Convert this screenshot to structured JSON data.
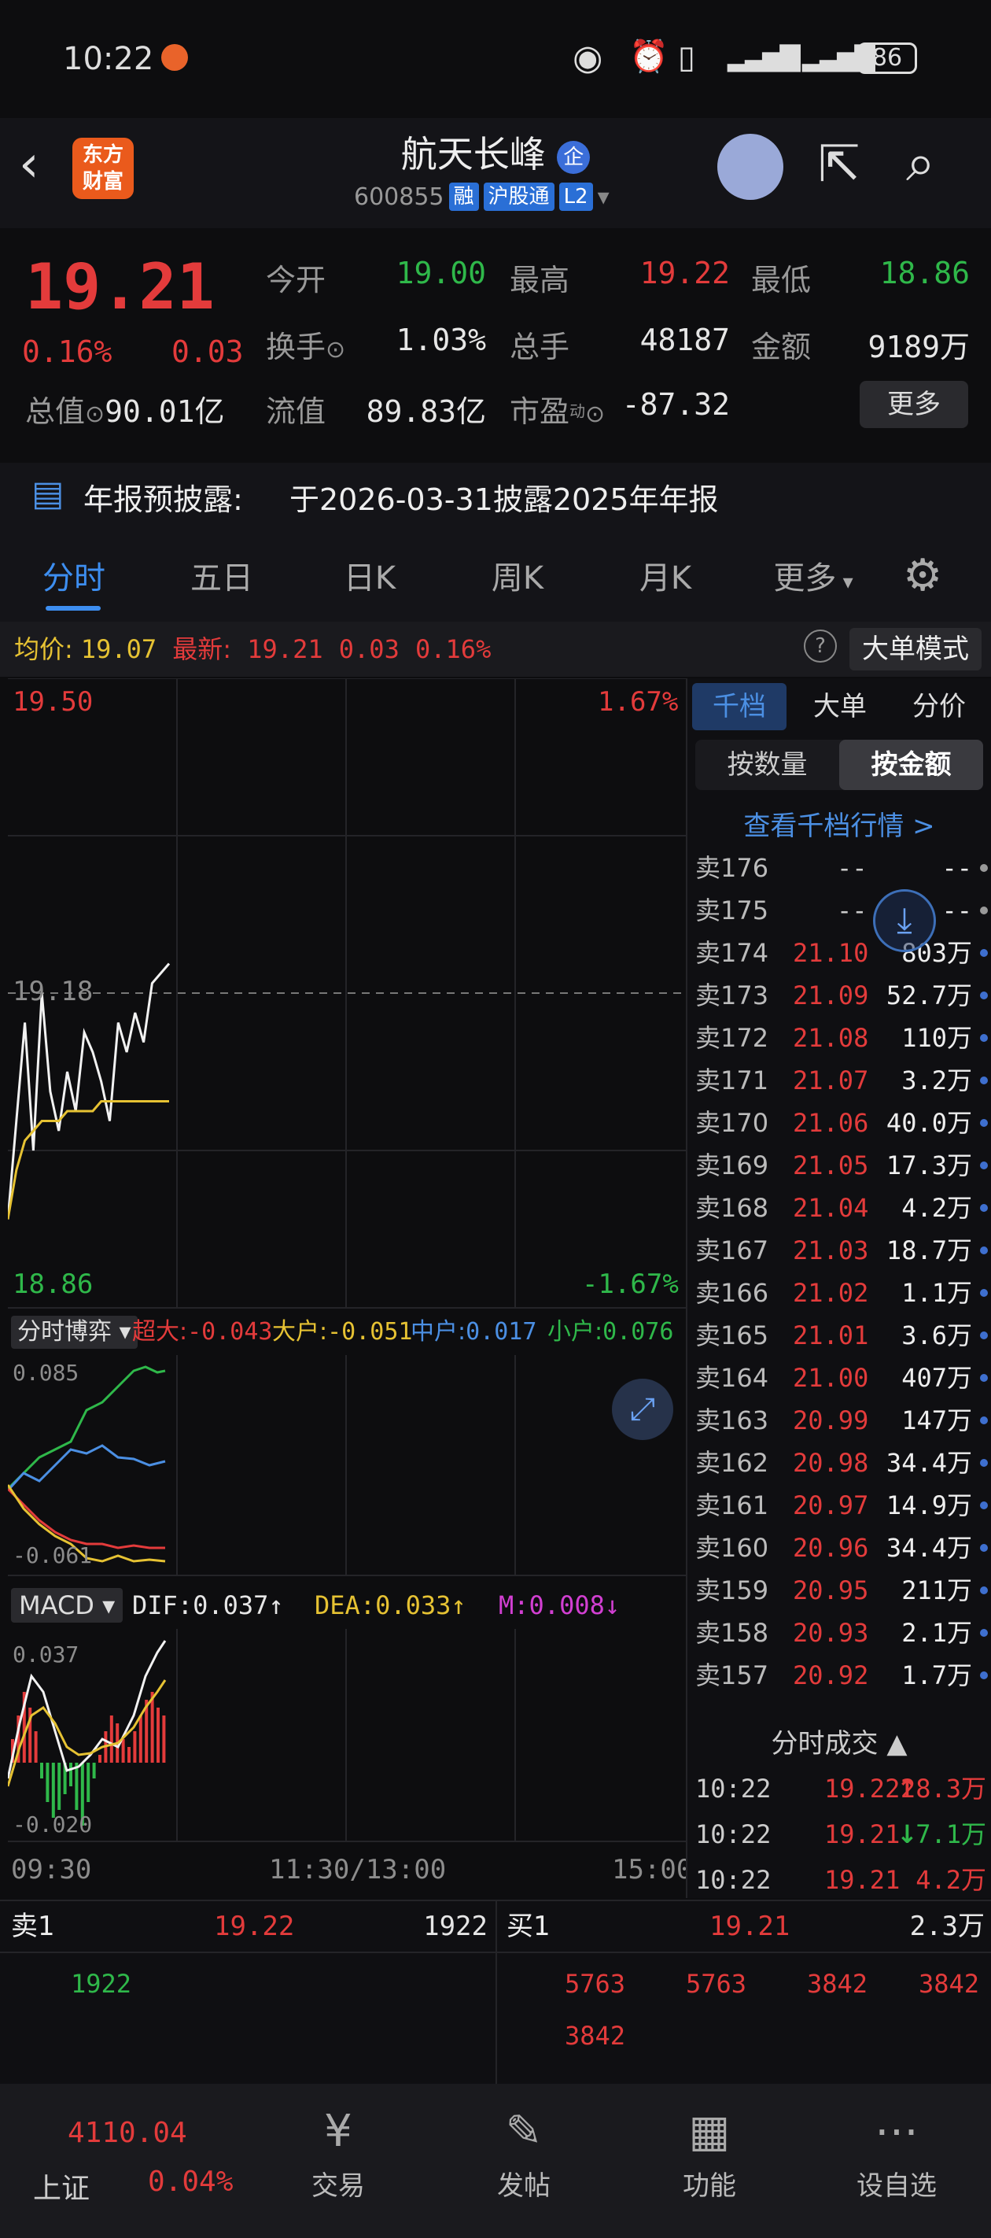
{
  "status": {
    "time": "10:22",
    "battery": "86"
  },
  "header": {
    "logo": [
      "东方",
      "财富"
    ],
    "title": "航天长峰",
    "badge": "企",
    "code": "600855",
    "tags": [
      "融",
      "沪股通",
      "L2"
    ]
  },
  "quote": {
    "price": "19.21",
    "change_pct": "0.16%",
    "change": "0.03",
    "fields": [
      {
        "label": "今开",
        "value": "19.00"
      },
      {
        "label": "最高",
        "value": "19.22"
      },
      {
        "label": "最低",
        "value": "18.86"
      },
      {
        "label": "换手",
        "value": "1.03%"
      },
      {
        "label": "总手",
        "value": "48187"
      },
      {
        "label": "金额",
        "value": "9189万"
      },
      {
        "label": "总值",
        "value": "90.01亿"
      },
      {
        "label": "流值",
        "value": "89.83亿"
      },
      {
        "label": "市盈",
        "value": "-87.32"
      }
    ],
    "pe_sup": "动",
    "more": "更多"
  },
  "notice": {
    "label": "年报预披露:",
    "text": "于2026-03-31披露2025年年报"
  },
  "tabs": [
    "分时",
    "五日",
    "日K",
    "周K",
    "月K",
    "更多"
  ],
  "infobar": {
    "avg_label": "均价:",
    "avg": "19.07",
    "new_label": "最新:",
    "new_price": "19.21",
    "new_chg": "0.03",
    "new_pct": "0.16%",
    "mode_btn": "大单模式"
  },
  "chart": {
    "price_top": "19.50",
    "pct_top": "1.67%",
    "price_bottom": "18.86",
    "pct_bottom": "-1.67%",
    "ref_line": "19.18",
    "time_start": "09:30",
    "time_mid": "11:30/13:00",
    "time_end": "15:00"
  },
  "chart_data": {
    "type": "line",
    "ylim": [
      18.86,
      19.5
    ],
    "series": [
      {
        "name": "",
        "values": [
          18.95,
          19.05,
          19.15,
          19.02,
          19.18,
          19.08,
          19.04,
          19.1,
          19.06,
          19.14,
          19.12,
          19.09,
          19.05,
          19.15,
          19.12,
          19.16,
          19.13,
          19.19,
          19.2,
          19.21
        ]
      },
      {
        "name": "均价",
        "values": [
          18.95,
          19.0,
          19.03,
          19.04,
          19.05,
          19.05,
          19.05,
          19.06,
          19.06,
          19.06,
          19.06,
          19.07,
          19.07,
          19.07,
          19.07,
          19.07,
          19.07,
          19.07,
          19.07,
          19.07
        ]
      }
    ]
  },
  "fund_flow": {
    "selector": "分时博弈",
    "items": [
      {
        "label": "超大:",
        "value": "-0.043"
      },
      {
        "label": "大户:",
        "value": "-0.051"
      },
      {
        "label": "中户:",
        "value": "0.017"
      },
      {
        "label": "小户:",
        "value": "0.076"
      }
    ],
    "ytop": "0.085",
    "ybottom": "-0.061"
  },
  "macd": {
    "selector": "MACD",
    "dif": "DIF:0.037",
    "dif_arrow": "↑",
    "dea": "DEA:0.033",
    "dea_arrow": "↑",
    "m": "M:0.008",
    "m_arrow": "↓",
    "ytop": "0.037",
    "ybottom": "-0.020"
  },
  "book": {
    "tabs": [
      "千档",
      "大单",
      "分价"
    ],
    "subtabs": [
      "按数量",
      "按金额"
    ],
    "link": "查看千档行情 >",
    "rows": [
      {
        "l": "卖176",
        "p": "--",
        "v": "--"
      },
      {
        "l": "卖175",
        "p": "--",
        "v": "--"
      },
      {
        "l": "卖174",
        "p": "21.10",
        "v": "803万"
      },
      {
        "l": "卖173",
        "p": "21.09",
        "v": "52.7万"
      },
      {
        "l": "卖172",
        "p": "21.08",
        "v": "110万"
      },
      {
        "l": "卖171",
        "p": "21.07",
        "v": "3.2万"
      },
      {
        "l": "卖170",
        "p": "21.06",
        "v": "40.0万"
      },
      {
        "l": "卖169",
        "p": "21.05",
        "v": "17.3万"
      },
      {
        "l": "卖168",
        "p": "21.04",
        "v": "4.2万"
      },
      {
        "l": "卖167",
        "p": "21.03",
        "v": "18.7万"
      },
      {
        "l": "卖166",
        "p": "21.02",
        "v": "1.1万"
      },
      {
        "l": "卖165",
        "p": "21.01",
        "v": "3.6万"
      },
      {
        "l": "卖164",
        "p": "21.00",
        "v": "407万"
      },
      {
        "l": "卖163",
        "p": "20.99",
        "v": "147万"
      },
      {
        "l": "卖162",
        "p": "20.98",
        "v": "34.4万"
      },
      {
        "l": "卖161",
        "p": "20.97",
        "v": "14.9万"
      },
      {
        "l": "卖160",
        "p": "20.96",
        "v": "34.4万"
      },
      {
        "l": "卖159",
        "p": "20.95",
        "v": "211万"
      },
      {
        "l": "卖158",
        "p": "20.93",
        "v": "2.1万"
      },
      {
        "l": "卖157",
        "p": "20.92",
        "v": "1.7万"
      }
    ],
    "trades_title": "分时成交",
    "trades": [
      {
        "t": "10:22",
        "p": "19.22",
        "dir": "↑",
        "v": "28.3万"
      },
      {
        "t": "10:22",
        "p": "19.21",
        "dir": "↓",
        "v": "7.1万"
      },
      {
        "t": "10:22",
        "p": "19.21",
        "dir": "",
        "v": "4.2万"
      }
    ]
  },
  "level1": {
    "sell_label": "卖1",
    "sell_price": "19.22",
    "sell_vol": "1922",
    "buy_label": "买1",
    "buy_price": "19.21",
    "buy_vol": "2.3万",
    "sell_orders": [
      "1922"
    ],
    "buy_orders": [
      "5763",
      "5763",
      "3842",
      "3842",
      "3842"
    ]
  },
  "nav": {
    "index_val": "4110.04",
    "index_name": "上证",
    "index_pct": "0.04%",
    "items": [
      "交易",
      "发帖",
      "功能",
      "设自选"
    ]
  }
}
